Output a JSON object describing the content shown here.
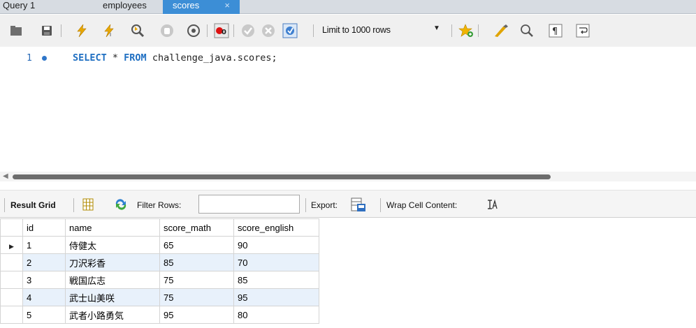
{
  "tabs": [
    {
      "label": "Query 1"
    },
    {
      "label": "employees"
    },
    {
      "label": "scores",
      "close": "×"
    }
  ],
  "toolbar": {
    "icons": [
      "open-folder-icon",
      "save-icon",
      "execute-icon",
      "execute-current-icon",
      "explain-icon",
      "stop-icon",
      "toggle-error-icon",
      "commit-icon",
      "rollback-icon",
      "autocommit-icon",
      "beautify-icon",
      "snippet-icon",
      "find-icon",
      "invisible-chars-icon",
      "wrap-icon"
    ],
    "limit_label": "Limit to 1000 rows"
  },
  "editor": {
    "line_number": "1",
    "kw_select": "SELECT",
    "star": " * ",
    "kw_from": "FROM",
    "table_ref": " challenge_java.scores;"
  },
  "result_toolbar": {
    "result_grid": "Result Grid",
    "filter_rows": "Filter Rows:",
    "filter_value": "",
    "export": "Export:",
    "wrap": "Wrap Cell Content:"
  },
  "grid": {
    "columns": [
      "id",
      "name",
      "score_math",
      "score_english"
    ],
    "rows": [
      [
        "1",
        "侍健太",
        "65",
        "90"
      ],
      [
        "2",
        "刀沢彩香",
        "85",
        "70"
      ],
      [
        "3",
        "戦国広志",
        "75",
        "85"
      ],
      [
        "4",
        "武士山美咲",
        "75",
        "95"
      ],
      [
        "5",
        "武者小路勇気",
        "95",
        "80"
      ]
    ]
  },
  "colors": {
    "active_tab": "#3c8ed6",
    "keyword": "#1f6fc2",
    "alt_row": "#e8f1fb"
  }
}
